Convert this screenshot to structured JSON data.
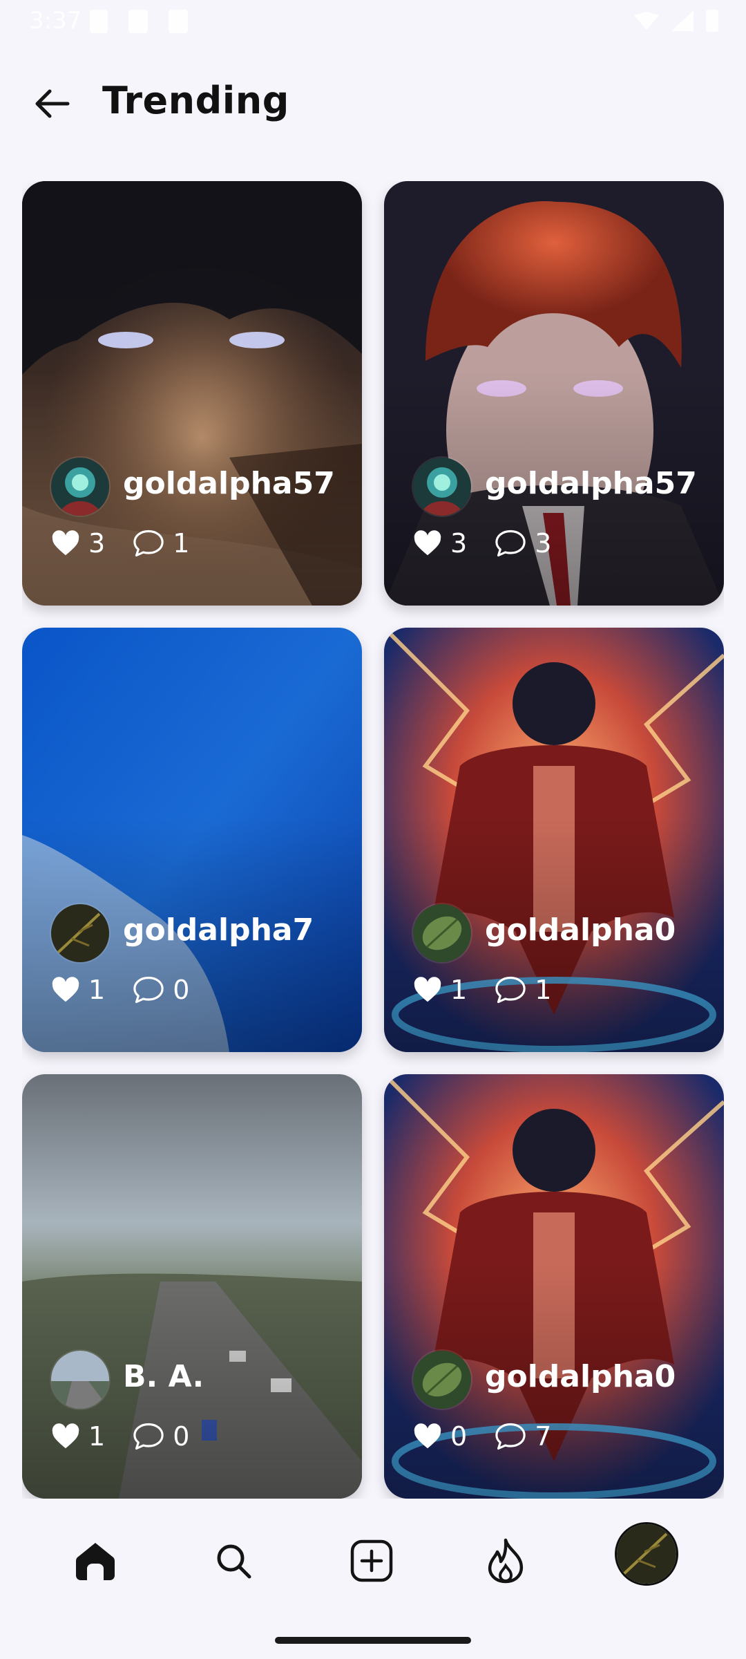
{
  "status_bar": {
    "time": "3:37"
  },
  "header": {
    "title": "Trending"
  },
  "cards": [
    {
      "username": "goldalpha57",
      "likes": "3",
      "comments": "1"
    },
    {
      "username": "goldalpha57",
      "likes": "3",
      "comments": "3"
    },
    {
      "username": "goldalpha7",
      "likes": "1",
      "comments": "0"
    },
    {
      "username": "goldalpha0",
      "likes": "1",
      "comments": "1"
    },
    {
      "username": "B. A.",
      "likes": "1",
      "comments": "0"
    },
    {
      "username": "goldalpha0",
      "likes": "0",
      "comments": "7"
    }
  ],
  "bottom_nav": {
    "items": [
      "home-icon",
      "search-icon",
      "create-post-icon",
      "trending-fire-icon",
      "profile-avatar"
    ]
  },
  "colors": {
    "background": "#F6F5FC",
    "text": "#121212"
  }
}
